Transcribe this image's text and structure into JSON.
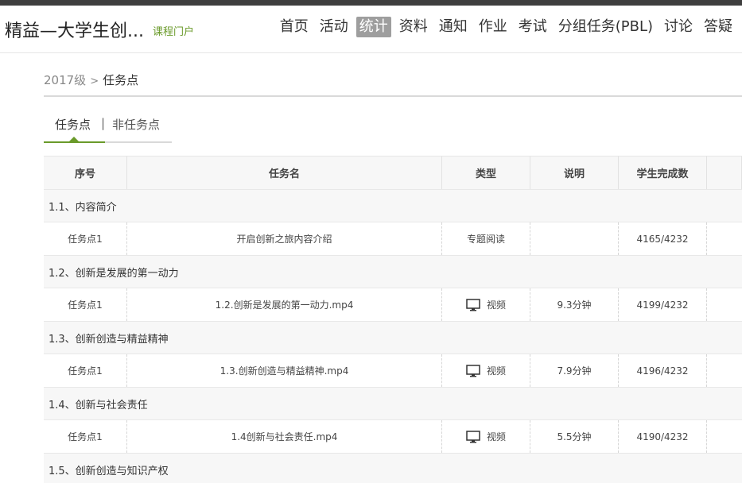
{
  "header": {
    "course_title": "精益—大学生创...",
    "portal_link": "课程门户",
    "nav": [
      "首页",
      "活动",
      "统计",
      "资料",
      "通知",
      "作业",
      "考试",
      "分组任务(PBL)",
      "讨论",
      "答疑"
    ],
    "active_nav": "统计"
  },
  "breadcrumb": {
    "grade": "2017级",
    "separator": ">",
    "current": "任务点"
  },
  "tabs": {
    "task_points": "任务点",
    "separator": "|",
    "non_task_points": "非任务点",
    "active": "任务点"
  },
  "table": {
    "headers": [
      "序号",
      "任务名",
      "类型",
      "说明",
      "学生完成数"
    ],
    "sections": [
      {
        "title": "1.1、内容简介",
        "items": [
          {
            "index": "任务点1",
            "name": "开启创新之旅内容介绍",
            "type": "专题阅读",
            "type_icon": "",
            "note": "",
            "completed": "4165/4232"
          }
        ]
      },
      {
        "title": "1.2、创新是发展的第一动力",
        "items": [
          {
            "index": "任务点1",
            "name": "1.2.创新是发展的第一动力.mp4",
            "type": "视频",
            "type_icon": "monitor-icon",
            "note": "9.3分钟",
            "completed": "4199/4232"
          }
        ]
      },
      {
        "title": "1.3、创新创造与精益精神",
        "items": [
          {
            "index": "任务点1",
            "name": "1.3.创新创造与精益精神.mp4",
            "type": "视频",
            "type_icon": "monitor-icon",
            "note": "7.9分钟",
            "completed": "4196/4232"
          }
        ]
      },
      {
        "title": "1.4、创新与社会责任",
        "items": [
          {
            "index": "任务点1",
            "name": "1.4创新与社会责任.mp4",
            "type": "视频",
            "type_icon": "monitor-icon",
            "note": "5.5分钟",
            "completed": "4190/4232"
          }
        ]
      },
      {
        "title": "1.5、创新创造与知识产权",
        "items": []
      }
    ]
  },
  "colors": {
    "accent": "#6a9a2a",
    "topbar": "#3f3f3f",
    "active_nav_bg": "#9e9e9e",
    "row_shade": "#f7f7f7"
  }
}
